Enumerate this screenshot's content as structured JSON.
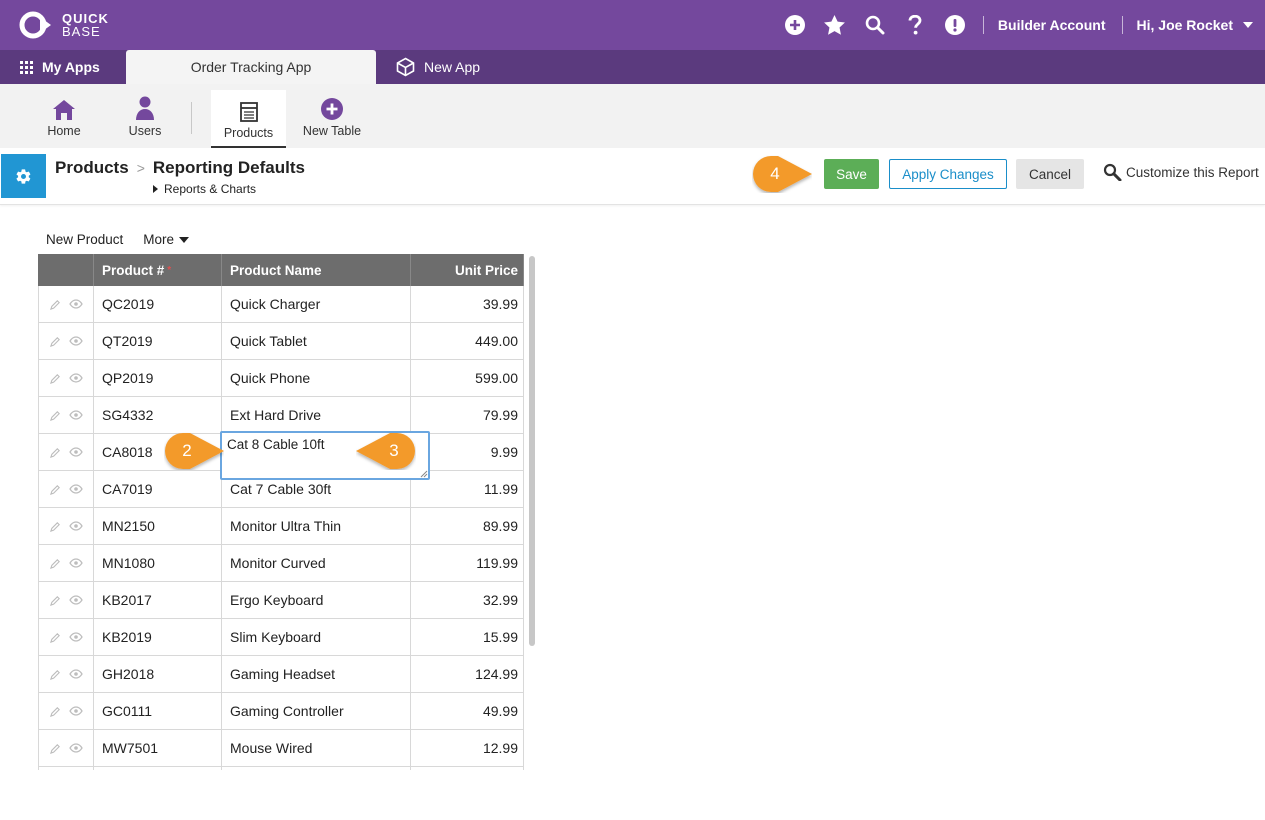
{
  "header": {
    "logo": {
      "line1": "QUICK",
      "line2": "BASE"
    },
    "icons": [
      "add-icon",
      "star-icon",
      "search-icon",
      "help-icon",
      "alert-icon"
    ],
    "builder_account": "Builder Account",
    "user_greeting": "Hi, Joe Rocket"
  },
  "app_tabs": {
    "my_apps": "My Apps",
    "active_app": "Order Tracking App",
    "new_app": "New App"
  },
  "table_nav": {
    "items": [
      {
        "label": "Home",
        "icon": "home-icon"
      },
      {
        "label": "Users",
        "icon": "user-icon"
      },
      {
        "label": "Products",
        "icon": "table-icon",
        "active": true
      },
      {
        "label": "New Table",
        "icon": "add-circle-icon"
      }
    ]
  },
  "page_header": {
    "breadcrumb_parent": "Products",
    "breadcrumb_current": "Reporting Defaults",
    "sub_link": "Reports & Charts",
    "buttons": {
      "save": "Save",
      "apply": "Apply Changes",
      "cancel": "Cancel",
      "customize": "Customize this Report"
    },
    "colors": {
      "save": "#5cae57",
      "apply": "#1a8ec9",
      "gear_box": "#2196d3"
    }
  },
  "callouts": {
    "two": "2",
    "three": "3",
    "four": "4",
    "color": "#f39a2c"
  },
  "report": {
    "toolbar": {
      "new_product": "New Product",
      "more": "More"
    },
    "columns": [
      "Product #",
      "Product Name",
      "Unit Price"
    ],
    "required_marker": "*",
    "editing_value": "Cat 8 Cable 10ft",
    "rows": [
      {
        "id": "QC2019",
        "name": "Quick Charger",
        "price": "39.99"
      },
      {
        "id": "QT2019",
        "name": "Quick Tablet",
        "price": "449.00"
      },
      {
        "id": "QP2019",
        "name": "Quick Phone",
        "price": "599.00"
      },
      {
        "id": "SG4332",
        "name": "Ext Hard Drive",
        "price": "79.99"
      },
      {
        "id": "CA8018",
        "name": "",
        "price": "9.99"
      },
      {
        "id": "CA7019",
        "name": "Cat 7 Cable 30ft",
        "price": "11.99"
      },
      {
        "id": "MN2150",
        "name": "Monitor Ultra Thin",
        "price": "89.99"
      },
      {
        "id": "MN1080",
        "name": "Monitor Curved",
        "price": "119.99"
      },
      {
        "id": "KB2017",
        "name": "Ergo Keyboard",
        "price": "32.99"
      },
      {
        "id": "KB2019",
        "name": "Slim Keyboard",
        "price": "15.99"
      },
      {
        "id": "GH2018",
        "name": "Gaming Headset",
        "price": "124.99"
      },
      {
        "id": "GC0111",
        "name": "Gaming Controller",
        "price": "49.99"
      },
      {
        "id": "MW7501",
        "name": "Mouse Wired",
        "price": "12.99"
      },
      {
        "id": "",
        "name": "",
        "price": ""
      }
    ]
  }
}
